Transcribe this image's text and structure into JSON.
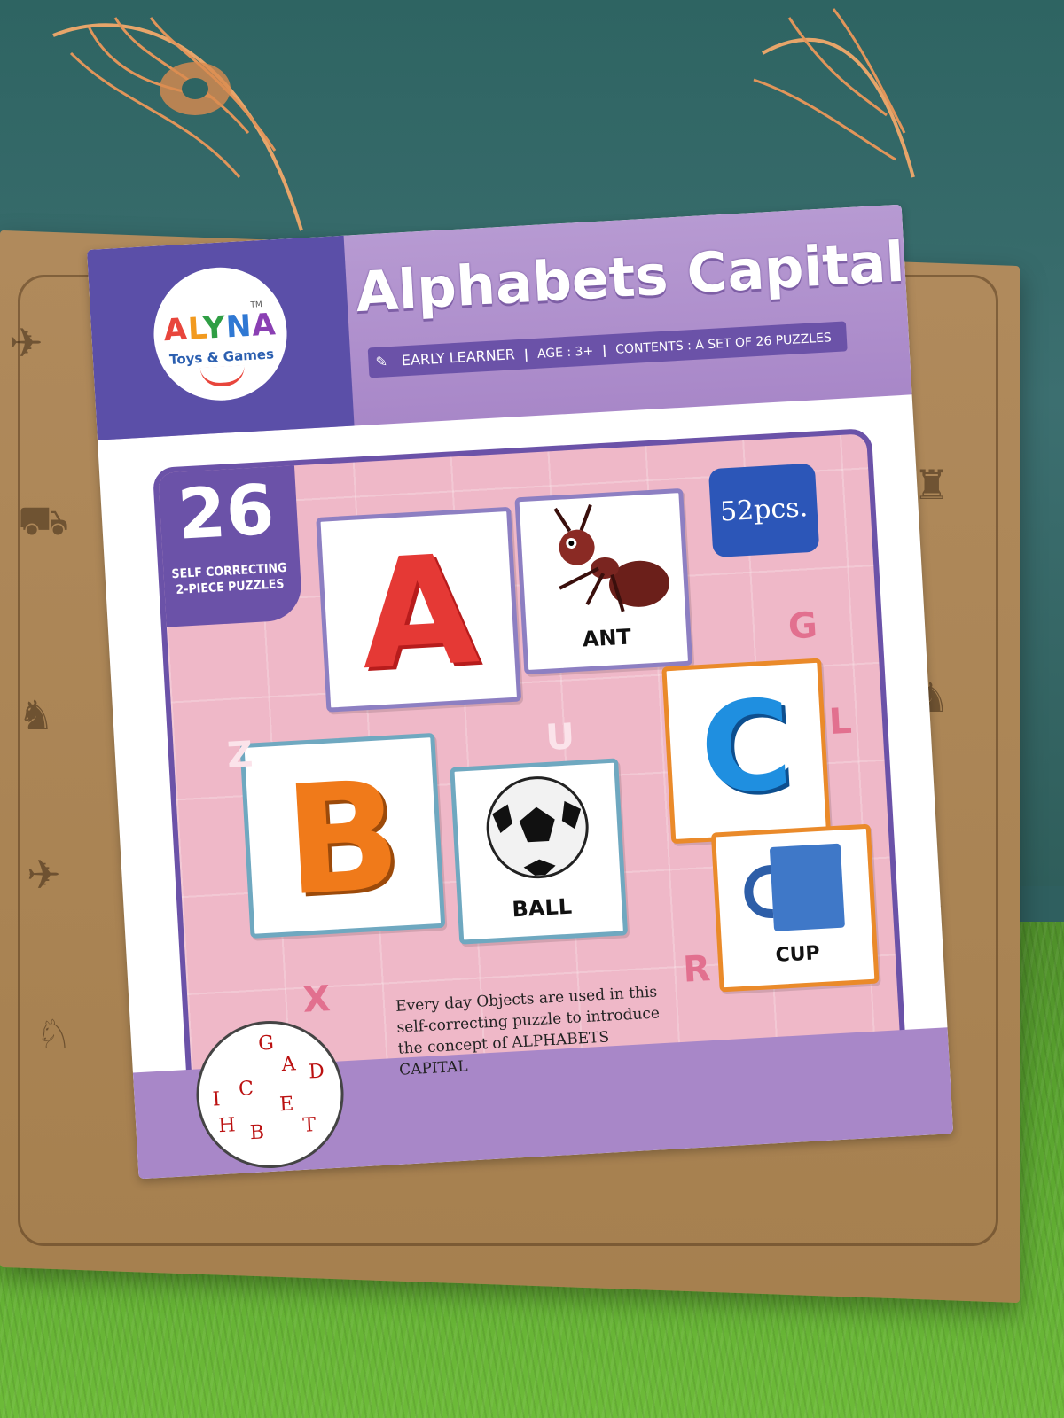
{
  "brand": {
    "logo_name": "ALYNA",
    "logo_tagline": "Toys & Games",
    "trademark": "TM"
  },
  "product": {
    "title": "Alphabets Capital",
    "info_early_learner": "EARLY LEARNER",
    "info_age": "AGE : 3+",
    "info_contents": "CONTENTS : A SET OF 26 PUZZLES",
    "badge_number": "26",
    "badge_line1": "SELF CORRECTING",
    "badge_line2": "2-PIECE PUZZLES",
    "pieces_label": "52pcs.",
    "blurb": "Every day Objects are used in this self-correcting puzzle to introduce the concept of ALPHABETS CAPITAL"
  },
  "puzzles": [
    {
      "letter": "A",
      "word": "ANT",
      "letter_color": "#e53935"
    },
    {
      "letter": "B",
      "word": "BALL",
      "letter_color": "#f07a1a"
    },
    {
      "letter": "C",
      "word": "CUP",
      "letter_color": "#1f8fe0"
    }
  ],
  "decor_letters": [
    "Z",
    "U",
    "G",
    "L",
    "X",
    "R"
  ],
  "globe_letters": [
    "G",
    "A",
    "D",
    "C",
    "I",
    "H",
    "B",
    "E",
    "T"
  ],
  "colors": {
    "header_purple": "#a887c8",
    "brand_blue": "#5b4fa8",
    "panel_pink": "#efb8c8",
    "pieces_blue": "#2c56b8"
  }
}
